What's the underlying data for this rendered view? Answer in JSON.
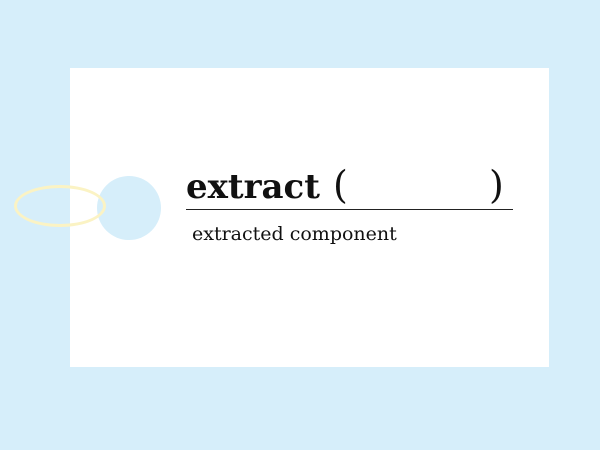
{
  "card": {
    "word": "extract",
    "open_paren": "(",
    "close_paren": ")",
    "meaning": "extracted component"
  },
  "colors": {
    "background": "#d6eefa",
    "card": "#ffffff",
    "ring": "#fbf3c4",
    "text": "#111111"
  }
}
